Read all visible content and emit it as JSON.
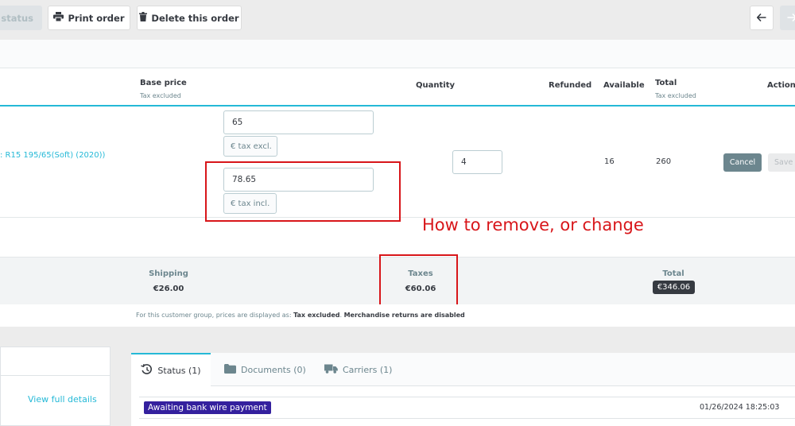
{
  "toolbar": {
    "status_label": "e status",
    "print_label": "Print order",
    "delete_label": "Delete this order"
  },
  "products_table": {
    "headers": {
      "base_price": "Base price",
      "base_price_sub": "Tax excluded",
      "quantity": "Quantity",
      "refunded": "Refunded",
      "available": "Available",
      "total": "Total",
      "total_sub": "Tax excluded",
      "actions": "Actions"
    },
    "row": {
      "product_name": ": R15 195/65(Soft) (2020))",
      "price_tax_excl": "65",
      "price_tax_excl_addon": "€ tax excl.",
      "price_tax_incl": "78.65",
      "price_tax_incl_addon": "€ tax incl.",
      "quantity": "4",
      "available": "16",
      "total": "260",
      "cancel_label": "Cancel",
      "save_label": "Save"
    }
  },
  "annotation": {
    "text": "How to remove, or change"
  },
  "summary": {
    "shipping_label": "Shipping",
    "shipping_value": "€26.00",
    "taxes_label": "Taxes",
    "taxes_value": "€60.06",
    "total_label": "Total",
    "total_value": "€346.06",
    "note_prefix": "For this customer group, prices are displayed as: ",
    "note_tax": "Tax excluded",
    "note_sep": ". ",
    "note_returns": "Merchandise returns are disabled"
  },
  "customer_panel": {
    "view_details": "View full details"
  },
  "tabs": [
    {
      "label": "Status (1)",
      "icon": "history-icon",
      "active": true
    },
    {
      "label": "Documents (0)",
      "icon": "folder-icon",
      "active": false
    },
    {
      "label": "Carriers (1)",
      "icon": "truck-icon",
      "active": false
    }
  ],
  "status_row": {
    "badge": "Awaiting bank wire payment",
    "badge_color": "#34209e",
    "date": "01/26/2024 18:25:03"
  },
  "colors": {
    "accent": "#25b9d7",
    "annotation_red": "#d8161a",
    "cancel_button": "#6c868e"
  }
}
